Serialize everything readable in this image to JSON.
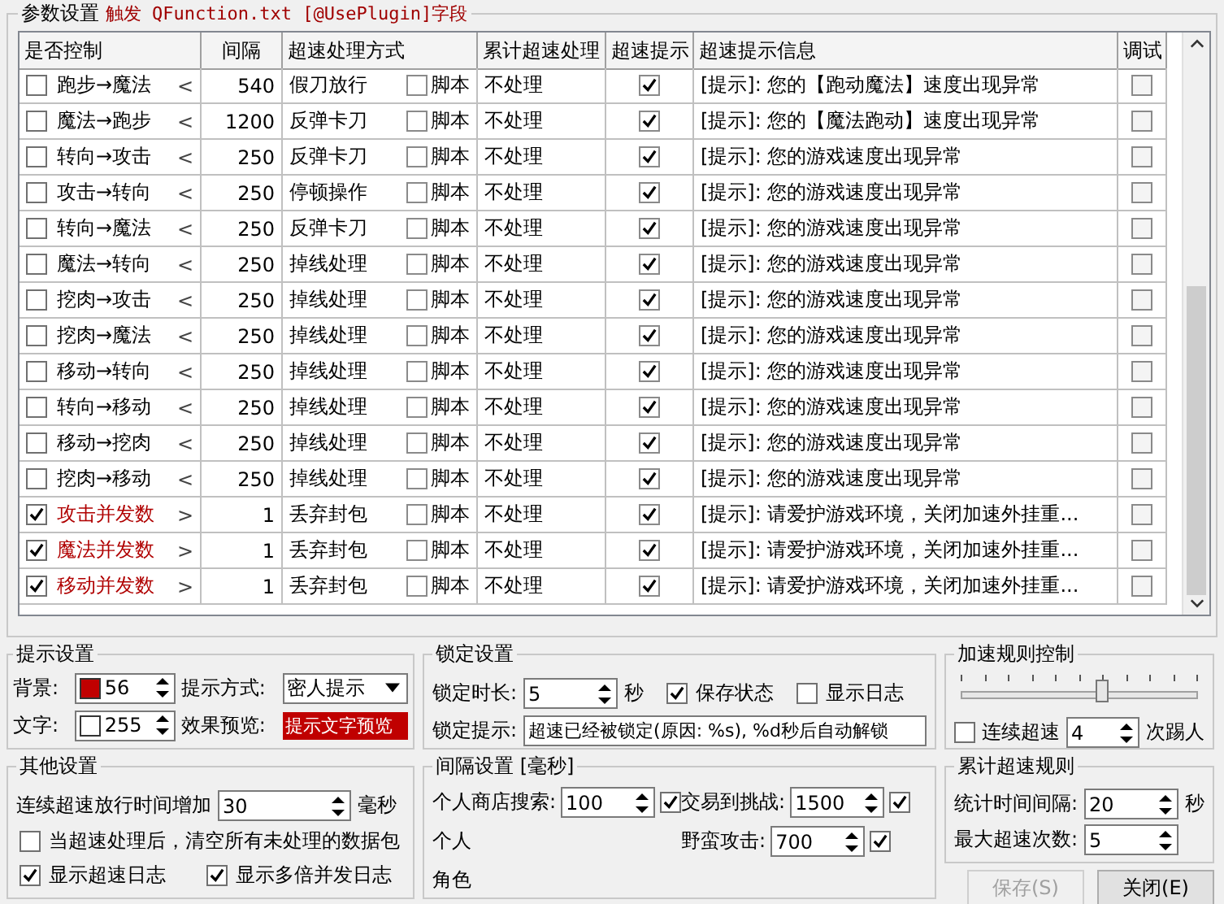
{
  "params": {
    "title": "参数设置",
    "note": "触发 QFunction.txt [@UsePlugin]字段"
  },
  "table": {
    "columns": [
      "是否控制",
      "间隔",
      "超速处理方式",
      "累计超速处理",
      "超速提示",
      "超速提示信息",
      "调试"
    ],
    "rows": [
      {
        "kind": "sequence",
        "checked": false,
        "name": "跑步→魔法",
        "arrow": "<",
        "interval": "540",
        "action": "假刀放行",
        "script_label": "脚本",
        "script_checked": false,
        "cumulative": "不处理",
        "alert": true,
        "message": "[提示]: 您的【跑动魔法】速度出现异常",
        "debug": false
      },
      {
        "kind": "sequence",
        "checked": false,
        "name": "魔法→跑步",
        "arrow": "<",
        "interval": "1200",
        "action": "反弹卡刀",
        "script_label": "脚本",
        "script_checked": false,
        "cumulative": "不处理",
        "alert": true,
        "message": "[提示]: 您的【魔法跑动】速度出现异常",
        "debug": false
      },
      {
        "kind": "sequence",
        "checked": false,
        "name": "转向→攻击",
        "arrow": "<",
        "interval": "250",
        "action": "反弹卡刀",
        "script_label": "脚本",
        "script_checked": false,
        "cumulative": "不处理",
        "alert": true,
        "message": "[提示]: 您的游戏速度出现异常",
        "debug": false
      },
      {
        "kind": "sequence",
        "checked": false,
        "name": "攻击→转向",
        "arrow": "<",
        "interval": "250",
        "action": "停顿操作",
        "script_label": "脚本",
        "script_checked": false,
        "cumulative": "不处理",
        "alert": true,
        "message": "[提示]: 您的游戏速度出现异常",
        "debug": false
      },
      {
        "kind": "sequence",
        "checked": false,
        "name": "转向→魔法",
        "arrow": "<",
        "interval": "250",
        "action": "反弹卡刀",
        "script_label": "脚本",
        "script_checked": false,
        "cumulative": "不处理",
        "alert": true,
        "message": "[提示]: 您的游戏速度出现异常",
        "debug": false
      },
      {
        "kind": "sequence",
        "checked": false,
        "name": "魔法→转向",
        "arrow": "<",
        "interval": "250",
        "action": "掉线处理",
        "script_label": "脚本",
        "script_checked": false,
        "cumulative": "不处理",
        "alert": true,
        "message": "[提示]: 您的游戏速度出现异常",
        "debug": false
      },
      {
        "kind": "sequence",
        "checked": false,
        "name": "挖肉→攻击",
        "arrow": "<",
        "interval": "250",
        "action": "掉线处理",
        "script_label": "脚本",
        "script_checked": false,
        "cumulative": "不处理",
        "alert": true,
        "message": "[提示]: 您的游戏速度出现异常",
        "debug": false
      },
      {
        "kind": "sequence",
        "checked": false,
        "name": "挖肉→魔法",
        "arrow": "<",
        "interval": "250",
        "action": "掉线处理",
        "script_label": "脚本",
        "script_checked": false,
        "cumulative": "不处理",
        "alert": true,
        "message": "[提示]: 您的游戏速度出现异常",
        "debug": false
      },
      {
        "kind": "sequence",
        "checked": false,
        "name": "移动→转向",
        "arrow": "<",
        "interval": "250",
        "action": "掉线处理",
        "script_label": "脚本",
        "script_checked": false,
        "cumulative": "不处理",
        "alert": true,
        "message": "[提示]: 您的游戏速度出现异常",
        "debug": false
      },
      {
        "kind": "sequence",
        "checked": false,
        "name": "转向→移动",
        "arrow": "<",
        "interval": "250",
        "action": "掉线处理",
        "script_label": "脚本",
        "script_checked": false,
        "cumulative": "不处理",
        "alert": true,
        "message": "[提示]: 您的游戏速度出现异常",
        "debug": false
      },
      {
        "kind": "sequence",
        "checked": false,
        "name": "移动→挖肉",
        "arrow": "<",
        "interval": "250",
        "action": "掉线处理",
        "script_label": "脚本",
        "script_checked": false,
        "cumulative": "不处理",
        "alert": true,
        "message": "[提示]: 您的游戏速度出现异常",
        "debug": false
      },
      {
        "kind": "sequence",
        "checked": false,
        "name": "挖肉→移动",
        "arrow": "<",
        "interval": "250",
        "action": "掉线处理",
        "script_label": "脚本",
        "script_checked": false,
        "cumulative": "不处理",
        "alert": true,
        "message": "[提示]: 您的游戏速度出现异常",
        "debug": false
      },
      {
        "kind": "concurrent",
        "checked": true,
        "name": "攻击并发数",
        "arrow": ">",
        "interval": "1",
        "action": "丢弃封包",
        "script_label": "脚本",
        "script_checked": false,
        "cumulative": "不处理",
        "alert": true,
        "message": "[提示]: 请爱护游戏环境，关闭加速外挂重...",
        "debug": false
      },
      {
        "kind": "concurrent",
        "checked": true,
        "name": "魔法并发数",
        "arrow": ">",
        "interval": "1",
        "action": "丢弃封包",
        "script_label": "脚本",
        "script_checked": false,
        "cumulative": "不处理",
        "alert": true,
        "message": "[提示]: 请爱护游戏环境，关闭加速外挂重...",
        "debug": false
      },
      {
        "kind": "concurrent",
        "checked": true,
        "name": "移动并发数",
        "arrow": ">",
        "interval": "1",
        "action": "丢弃封包",
        "script_label": "脚本",
        "script_checked": false,
        "cumulative": "不处理",
        "alert": true,
        "message": "[提示]: 请爱护游戏环境，关闭加速外挂重...",
        "debug": false
      }
    ]
  },
  "tip": {
    "title": "提示设置",
    "colors": [
      {
        "label": "背景:",
        "color": "#c00000",
        "value": "56"
      },
      {
        "label": "文字:",
        "color": "#ffffff",
        "value": "255"
      }
    ],
    "mode_label": "提示方式:",
    "mode_value": "密人提示",
    "preview_label": "效果预览:",
    "preview_text": "提示文字预览"
  },
  "lock": {
    "title": "锁定设置",
    "duration_label": "锁定时长:",
    "duration_value": "5",
    "duration_unit": "秒",
    "options": [
      {
        "label": "保存状态",
        "checked": true
      },
      {
        "label": "显示日志",
        "checked": false
      }
    ],
    "message_label": "锁定提示:",
    "message_value": "超速已经被锁定(原因: %s), %d秒后自动解锁"
  },
  "rule": {
    "title": "加速规则控制",
    "level": 0.6,
    "consecutive_label": "连续超速",
    "consecutive_checked": false,
    "consecutive_value": "4",
    "consecutive_unit": "次踢人"
  },
  "other": {
    "title": "其他设置",
    "increase_label": "连续超速放行时间增加",
    "increase_value": "30",
    "increase_unit": "毫秒",
    "options": [
      {
        "label": "当超速处理后，清空所有未处理的数据包",
        "checked": false
      },
      {
        "label": "显示超速日志",
        "checked": true
      },
      {
        "label": "显示多倍并发日志",
        "checked": true
      }
    ]
  },
  "interval": {
    "title": "间隔设置 [毫秒]",
    "items": [
      {
        "label": "个人商店搜索:",
        "value": "100",
        "checked": true
      },
      {
        "label": "交易到挑战:",
        "value": "1500",
        "checked": true
      },
      {
        "label": "个人"
      },
      {
        "label": "野蛮攻击:",
        "value": "700",
        "checked": true
      },
      {
        "label": "角色"
      }
    ]
  },
  "cumulative": {
    "title": "累计超速规则",
    "items": [
      {
        "label": "统计时间间隔:",
        "value": "20",
        "unit": "秒"
      },
      {
        "label": "最大超速次数:",
        "value": "5"
      }
    ]
  },
  "buttons": [
    {
      "label": "保存(S)",
      "disabled": true
    },
    {
      "label": "关闭(E)",
      "disabled": false
    }
  ]
}
